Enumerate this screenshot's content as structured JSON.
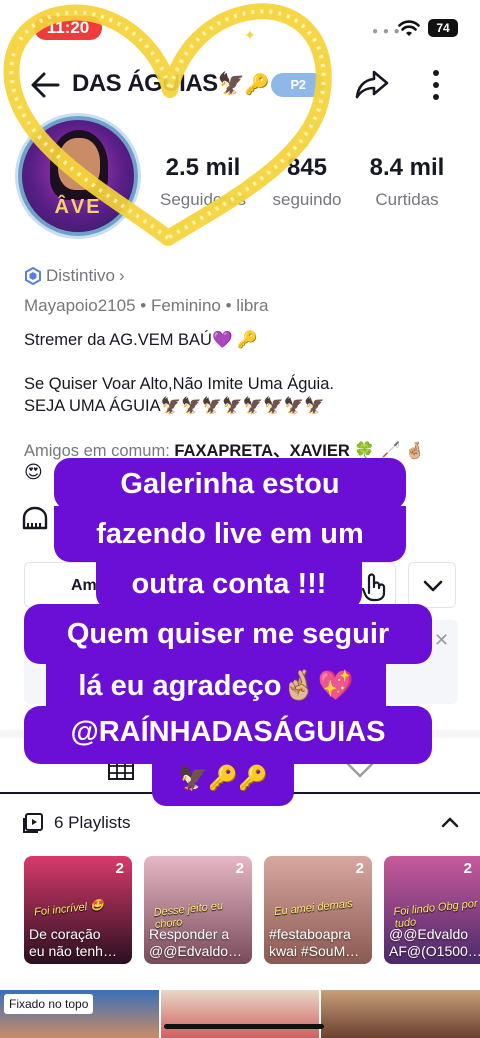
{
  "status_bar": {
    "time": "11:20",
    "battery": "74"
  },
  "header": {
    "title": "DAS ÁGUIAS",
    "level_badge": "P2"
  },
  "avatar": {
    "text": "ÂVE"
  },
  "stats": [
    {
      "value": "2.5 mil",
      "label": "Seguidores"
    },
    {
      "value": "845",
      "label": "seguindo"
    },
    {
      "value": "8.4 mil",
      "label": "Curtidas"
    }
  ],
  "profile": {
    "badge": "Distintivo",
    "username": "Mayapoio2105",
    "gender": "Feminino",
    "sign": "libra",
    "bio": "Stremer da AG.VEM BAÚ💜 🔑\n\nSe Quiser Voar Alto,Não Imite Uma Águia.\nSEJA UMA ÁGUIA🦅🦅🦅🦅🦅🦅🦅🦅",
    "friends_prefix": "Amigos em comum: ",
    "friends_names": "FAXAPRETA、XAVIER",
    "friends_suffix": " 🍀 🦯 🤞🏼",
    "friends_emoji": "😍"
  },
  "actions": {
    "friends_button": "Amigos"
  },
  "playlists": {
    "title": "6 Playlists",
    "items": [
      {
        "count": "2",
        "title": "De coração\neu não tenh…",
        "caption": "Foi incrível 🤩",
        "color_top": "#d83a6b",
        "color_bottom": "#2a1020"
      },
      {
        "count": "2",
        "title": "Responder a\n@@Edvaldo…",
        "caption": "Desse jeito eu choro",
        "color_top": "#e6b8c6",
        "color_bottom": "#7a4a5a"
      },
      {
        "count": "2",
        "title": "#festaboapra\nkwai #SouM…",
        "caption": "Eu amei demais",
        "color_top": "#d8a8a0",
        "color_bottom": "#8a5a52"
      },
      {
        "count": "2",
        "title": "@@Edvaldo\nAF@(O1500…",
        "caption": "Foi lindo Obg por tudo",
        "color_top": "#c85a9a",
        "color_bottom": "#4a2a6a"
      }
    ]
  },
  "video_strip": {
    "pinned_label": "Fixado no topo"
  },
  "banner": {
    "lines": [
      "Galerinha estou",
      "fazendo live em um",
      "outra conta !!!",
      "Quem quiser me seguir",
      "lá eu agradeço🤞🏼💖",
      "@RAÍNHADASÁGUIAS",
      "🦅🔑🔑"
    ]
  },
  "colors": {
    "banner": "#6c0fd6",
    "heart": "#f5d33a",
    "muted_text": "#75777e"
  }
}
